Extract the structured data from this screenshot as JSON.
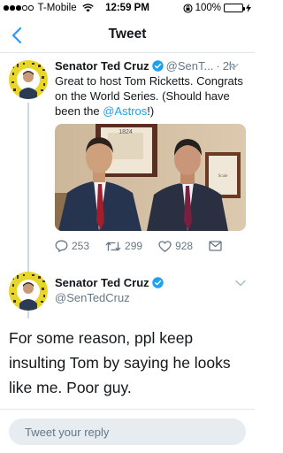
{
  "statusbar": {
    "carrier": "T-Mobile",
    "time": "12:59 PM",
    "battery": "100%",
    "battery_level": 1.0,
    "signal_bars": 3
  },
  "nav": {
    "title": "Tweet",
    "back_icon": "chevron-left-icon"
  },
  "tweet1": {
    "name": "Senator Ted Cruz",
    "handle": "@SenT...",
    "sep": "·",
    "time": "2h",
    "text_pre": "Great to host Tom Ricketts. Congrats on the World Series. (Should have been the ",
    "mention": "@Astros",
    "text_post": "!)",
    "photo_sign": "1824",
    "photo_frame": "Scale",
    "replies": "253",
    "retweets": "299",
    "likes": "928"
  },
  "tweet2": {
    "name": "Senator Ted Cruz",
    "handle": "@SenTedCruz",
    "text": "For some reason, ppl keep insulting Tom by saying he looks like me. Poor guy."
  },
  "reply_box": {
    "placeholder": "Tweet your reply"
  },
  "colors": {
    "accent": "#1da1f2",
    "muted": "#657786",
    "border": "#e1e8ed",
    "battery": "#4cd964"
  }
}
